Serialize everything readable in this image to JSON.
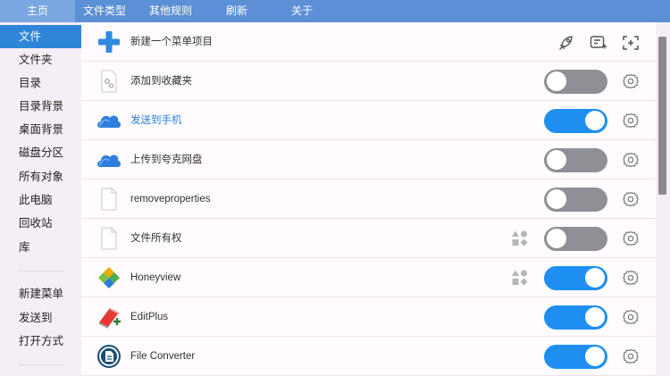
{
  "tabs": [
    {
      "label": "主页",
      "active": true
    },
    {
      "label": "文件类型",
      "active": false
    },
    {
      "label": "其他规则",
      "active": false
    },
    {
      "label": "刷新",
      "active": false
    },
    {
      "label": "关于",
      "active": false
    }
  ],
  "sidebar": {
    "items": [
      {
        "label": "文件",
        "active": true
      },
      {
        "label": "文件夹"
      },
      {
        "label": "目录"
      },
      {
        "label": "目录背景"
      },
      {
        "label": "桌面背景"
      },
      {
        "label": "磁盘分区"
      },
      {
        "label": "所有对象"
      },
      {
        "label": "此电脑"
      },
      {
        "label": "回收站"
      },
      {
        "label": "库"
      }
    ],
    "secondary": [
      {
        "label": "新建菜单"
      },
      {
        "label": "发送到"
      },
      {
        "label": "打开方式"
      }
    ]
  },
  "header_row": {
    "label": "新建一个菜单项目",
    "tools": [
      "rocket-icon",
      "edit-list-icon",
      "add-frame-icon"
    ]
  },
  "rows": [
    {
      "label": "添加到收藏夹",
      "enabled": false,
      "icon": "favorites-file-icon",
      "link": false,
      "shapes": false
    },
    {
      "label": "发送到手机",
      "enabled": true,
      "icon": "cloud-icon",
      "link": true,
      "shapes": false
    },
    {
      "label": "上传到夸克网盘",
      "enabled": false,
      "icon": "cloud-icon",
      "link": false,
      "shapes": false
    },
    {
      "label": "removeproperties",
      "enabled": false,
      "icon": "blank-file-icon",
      "link": false,
      "shapes": false
    },
    {
      "label": "文件所有权",
      "enabled": false,
      "icon": "blank-file-icon",
      "link": false,
      "shapes": true
    },
    {
      "label": "Honeyview",
      "enabled": true,
      "icon": "honeyview-icon",
      "link": false,
      "shapes": true
    },
    {
      "label": "EditPlus",
      "enabled": true,
      "icon": "editplus-icon",
      "link": false,
      "shapes": false
    },
    {
      "label": "File Converter",
      "enabled": true,
      "icon": "file-converter-icon",
      "link": false,
      "shapes": false
    }
  ],
  "colors": {
    "accent": "#2f85d8",
    "toggle_on": "#1e8ff1",
    "toggle_off": "#8f9096",
    "topbar": "#5b8fd6"
  }
}
